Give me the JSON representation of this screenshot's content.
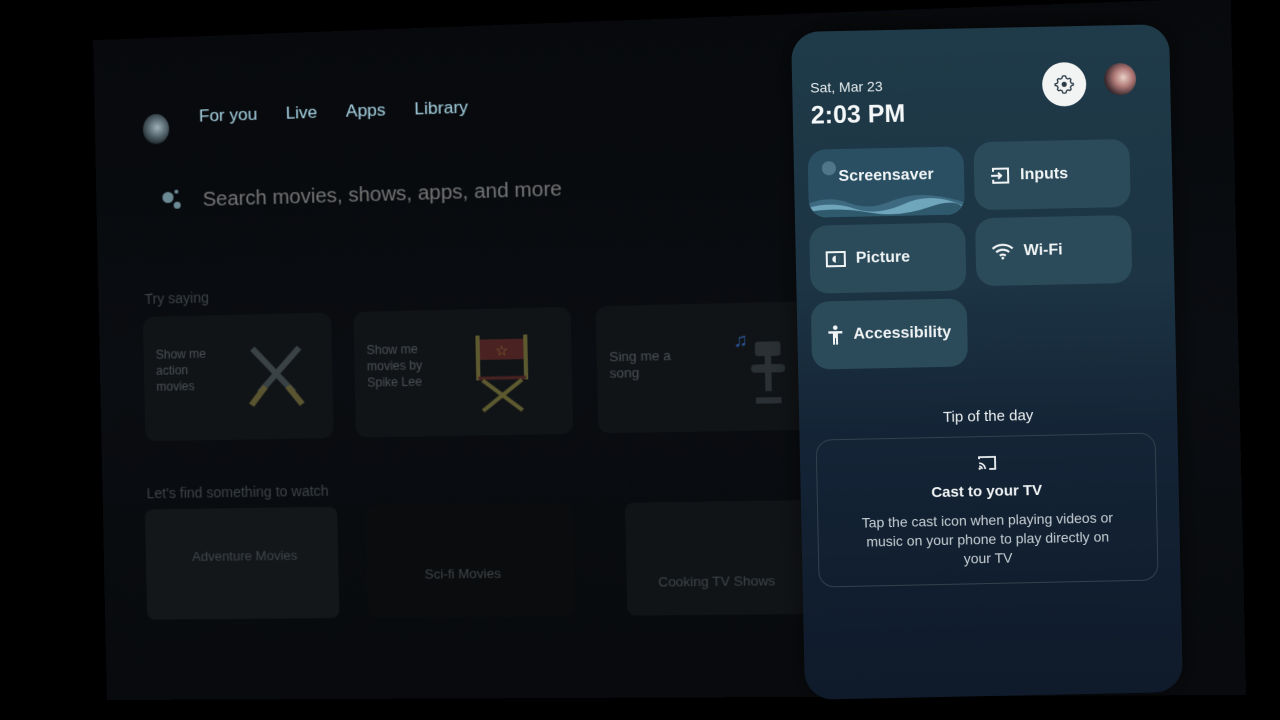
{
  "home": {
    "nav_tabs": [
      "For you",
      "Live",
      "Apps",
      "Library"
    ],
    "search": {
      "placeholder": "Search movies, shows, apps, and more"
    },
    "try_saying": {
      "label": "Try saying",
      "cards": [
        {
          "text": "Show me action movies",
          "icon": "crossed-swords-icon"
        },
        {
          "text": "Show me movies by Spike Lee",
          "icon": "director-chair-icon"
        },
        {
          "text": "Sing me a song",
          "icon": "microphone-music-icon"
        }
      ]
    },
    "watch": {
      "label": "Let's find something to watch",
      "cards": [
        {
          "text": "Adventure Movies"
        },
        {
          "text": "Sci-fi Movies"
        },
        {
          "text": "Cooking TV Shows"
        }
      ]
    }
  },
  "quick_settings": {
    "date": "Sat, Mar 23",
    "time": "2:03 PM",
    "settings_icon": "gear-icon",
    "tiles": [
      {
        "label": "Screensaver",
        "icon": "screensaver-waves-icon"
      },
      {
        "label": "Inputs",
        "icon": "input-icon"
      },
      {
        "label": "Picture",
        "icon": "picture-icon"
      },
      {
        "label": "Wi-Fi",
        "icon": "wifi-icon"
      },
      {
        "label": "Accessibility",
        "icon": "accessibility-icon"
      }
    ],
    "tip": {
      "section_title": "Tip of the day",
      "icon": "cast-icon",
      "title": "Cast to your TV",
      "body": "Tap the cast icon when playing videos or music on your phone to play directly on your TV"
    }
  },
  "colors": {
    "panel_top": "#1f3a48",
    "panel_bottom": "#0f1a2a",
    "tile": "#2b4a5a",
    "nav_text": "#a9d6e6"
  }
}
